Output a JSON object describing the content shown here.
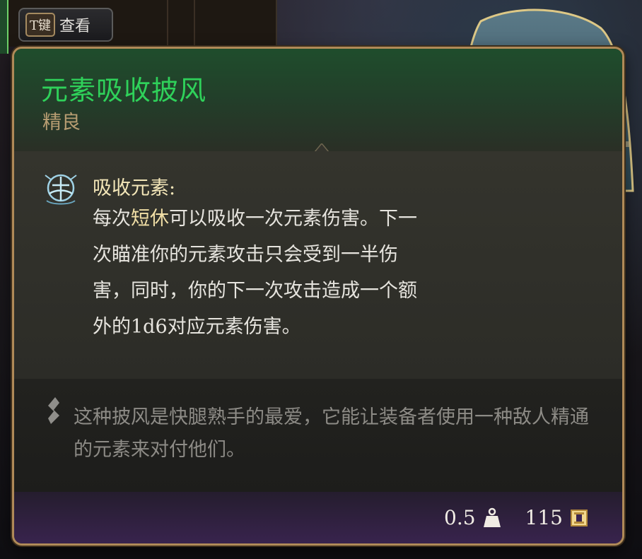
{
  "hotkey": {
    "key": "T键",
    "label": "查看"
  },
  "item": {
    "name": "元素吸收披风",
    "rarity": "精良",
    "name_color": "#2fd15a",
    "rarity_color": "#b79d72"
  },
  "passive": {
    "icon": "elemental-absorb-icon",
    "name": "吸收元素:",
    "desc_pre": "每次",
    "desc_keyword": "短休",
    "desc_post": "可以吸收一次元素伤害。下一次瞄准你的元素攻击只会受到一半伤害，同时，你的下一次攻击造成一个额外的1d6对应元素伤害。"
  },
  "lore": {
    "icon": "quote-icon",
    "text": "这种披风是快腿熟手的最爱，它能让装备者使用一种敌人精通的元素来对付他们。"
  },
  "footer": {
    "weight": "0.5",
    "weight_icon": "weight-icon",
    "value": "115",
    "value_icon": "gold-icon"
  },
  "colors": {
    "border": "#b08a58",
    "header_green": "#1f4d2c",
    "footer_purple": "#3a2450"
  }
}
